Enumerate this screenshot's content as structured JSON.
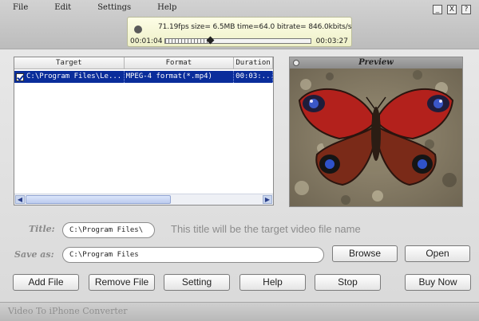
{
  "menu": {
    "file": "File",
    "edit": "Edit",
    "settings": "Settings",
    "help": "Help"
  },
  "window_controls": {
    "minimize": "_",
    "close": "X",
    "help": "?"
  },
  "status": {
    "stats": "71.19fps size= 6.5MB time=64.0 bitrate= 846.0kbits/s",
    "elapsed": "00:01:04",
    "total": "00:03:27",
    "progress": 0.31
  },
  "table": {
    "headers": [
      "Target",
      "Format",
      "Duration"
    ],
    "rows": [
      {
        "checked": true,
        "target": "C:\\Program Files\\Le...",
        "format": "MPEG-4 format(*.mp4)",
        "duration": "00:03:..."
      }
    ]
  },
  "preview": {
    "title": "Preview"
  },
  "title_field": {
    "label": "Title:",
    "value": "C:\\Program Files\\",
    "hint": "This title will be the target video file name"
  },
  "save_field": {
    "label": "Save as:",
    "value": "C:\\Program Files"
  },
  "buttons": {
    "browse": "Browse",
    "open": "Open",
    "add_file": "Add File",
    "remove_file": "Remove File",
    "setting": "Setting",
    "help": "Help",
    "stop": "Stop",
    "buy_now": "Buy Now"
  },
  "footer": {
    "app_name": "Video To iPhone Converter"
  }
}
